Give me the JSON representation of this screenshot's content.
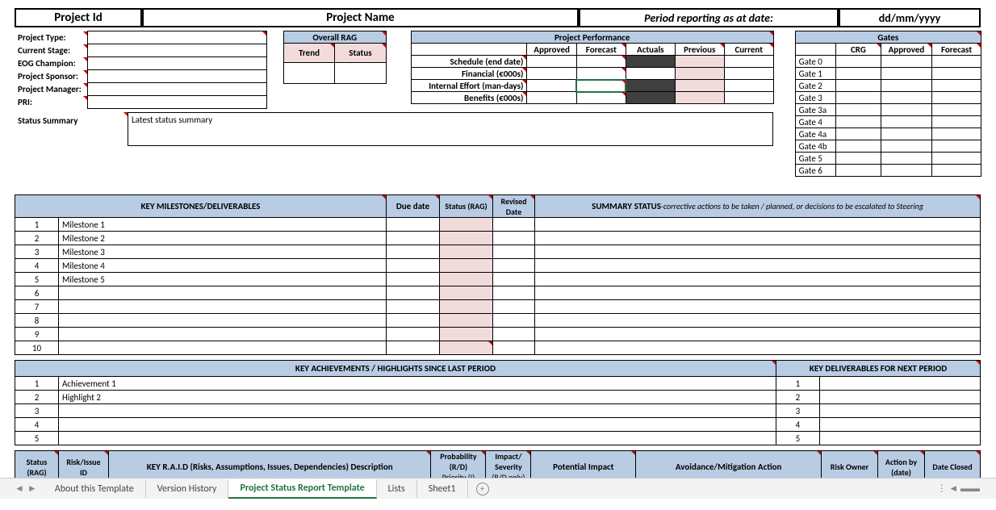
{
  "header": {
    "project_id": "Project Id",
    "project_name": "Project Name",
    "period_label": "Period reporting as at date:",
    "date_value": "dd/mm/yyyy"
  },
  "info_labels": {
    "type": "Project Type:",
    "stage": "Current Stage:",
    "eog": "EOG Champion:",
    "sponsor": "Project Sponsor:",
    "manager": "Project Manager:",
    "pri": "PRI:"
  },
  "overall_rag": {
    "title": "Overall RAG",
    "trend": "Trend",
    "status": "Status"
  },
  "performance": {
    "title": "Project Performance",
    "cols": {
      "approved": "Approved",
      "forecast": "Forecast",
      "actuals": "Actuals",
      "previous": "Previous",
      "current": "Current"
    },
    "rows": {
      "schedule": "Schedule (end date)",
      "financial": "Financial (€000s)",
      "effort": "Internal Effort (man-days)",
      "benefits": "Benefits (€000s)"
    }
  },
  "gates": {
    "title": "Gates",
    "cols": {
      "crg": "CRG",
      "approved": "Approved",
      "forecast": "Forecast"
    },
    "rows": [
      "Gate 0",
      "Gate 1",
      "Gate 2",
      "Gate 3",
      "Gate 3a",
      "Gate 4",
      "Gate 4a",
      "Gate 4b",
      "Gate 5",
      "Gate 6"
    ]
  },
  "status_summary": {
    "label": "Status Summary",
    "value": "Latest status summary"
  },
  "milestones": {
    "header": "KEY MILESTONES/DELIVERABLES",
    "due": "Due date",
    "status": "Status (RAG)",
    "revised": "Revised Date",
    "summary": "SUMMARY STATUS",
    "summary_sub": "-corrective actions to be taken / planned, or decisions to be escalated to Steering",
    "rows": [
      {
        "n": "1",
        "name": "Milestone 1"
      },
      {
        "n": "2",
        "name": "Milestone 2"
      },
      {
        "n": "3",
        "name": "Milestone 3"
      },
      {
        "n": "4",
        "name": "Milestone 4"
      },
      {
        "n": "5",
        "name": "Milestone 5"
      },
      {
        "n": "6",
        "name": ""
      },
      {
        "n": "7",
        "name": ""
      },
      {
        "n": "8",
        "name": ""
      },
      {
        "n": "9",
        "name": ""
      },
      {
        "n": "10",
        "name": ""
      }
    ]
  },
  "achievements": {
    "left_header": "KEY ACHIEVEMENTS / HIGHLIGHTS SINCE LAST PERIOD",
    "right_header": "KEY DELIVERABLES FOR NEXT PERIOD",
    "left_rows": [
      {
        "n": "1",
        "v": "Achievement 1"
      },
      {
        "n": "2",
        "v": "Highlight 2"
      },
      {
        "n": "3",
        "v": ""
      },
      {
        "n": "4",
        "v": ""
      },
      {
        "n": "5",
        "v": ""
      }
    ],
    "right_rows": [
      {
        "n": "1",
        "v": ""
      },
      {
        "n": "2",
        "v": ""
      },
      {
        "n": "3",
        "v": ""
      },
      {
        "n": "4",
        "v": ""
      },
      {
        "n": "5",
        "v": ""
      }
    ]
  },
  "raid": {
    "status": "Status (RAG)",
    "id": "Risk/Issue ID",
    "desc": "KEY R.A.I.D (Risks, Assumptions, Issues, Dependencies) Description",
    "prob": "Probability (R/D)",
    "prob2": "Priority (I)",
    "impact": "Impact/ Severity",
    "impact2": "(R/D only)",
    "potential": "Potential Impact",
    "mitigation": "Avoidance/Mitigation Action",
    "owner": "Risk Owner",
    "action": "Action by (date)",
    "closed": "Date Closed"
  },
  "tabs": {
    "about": "About this Template",
    "version": "Version History",
    "active": "Project Status Report Template",
    "lists": "Lists",
    "sheet1": "Sheet1"
  }
}
